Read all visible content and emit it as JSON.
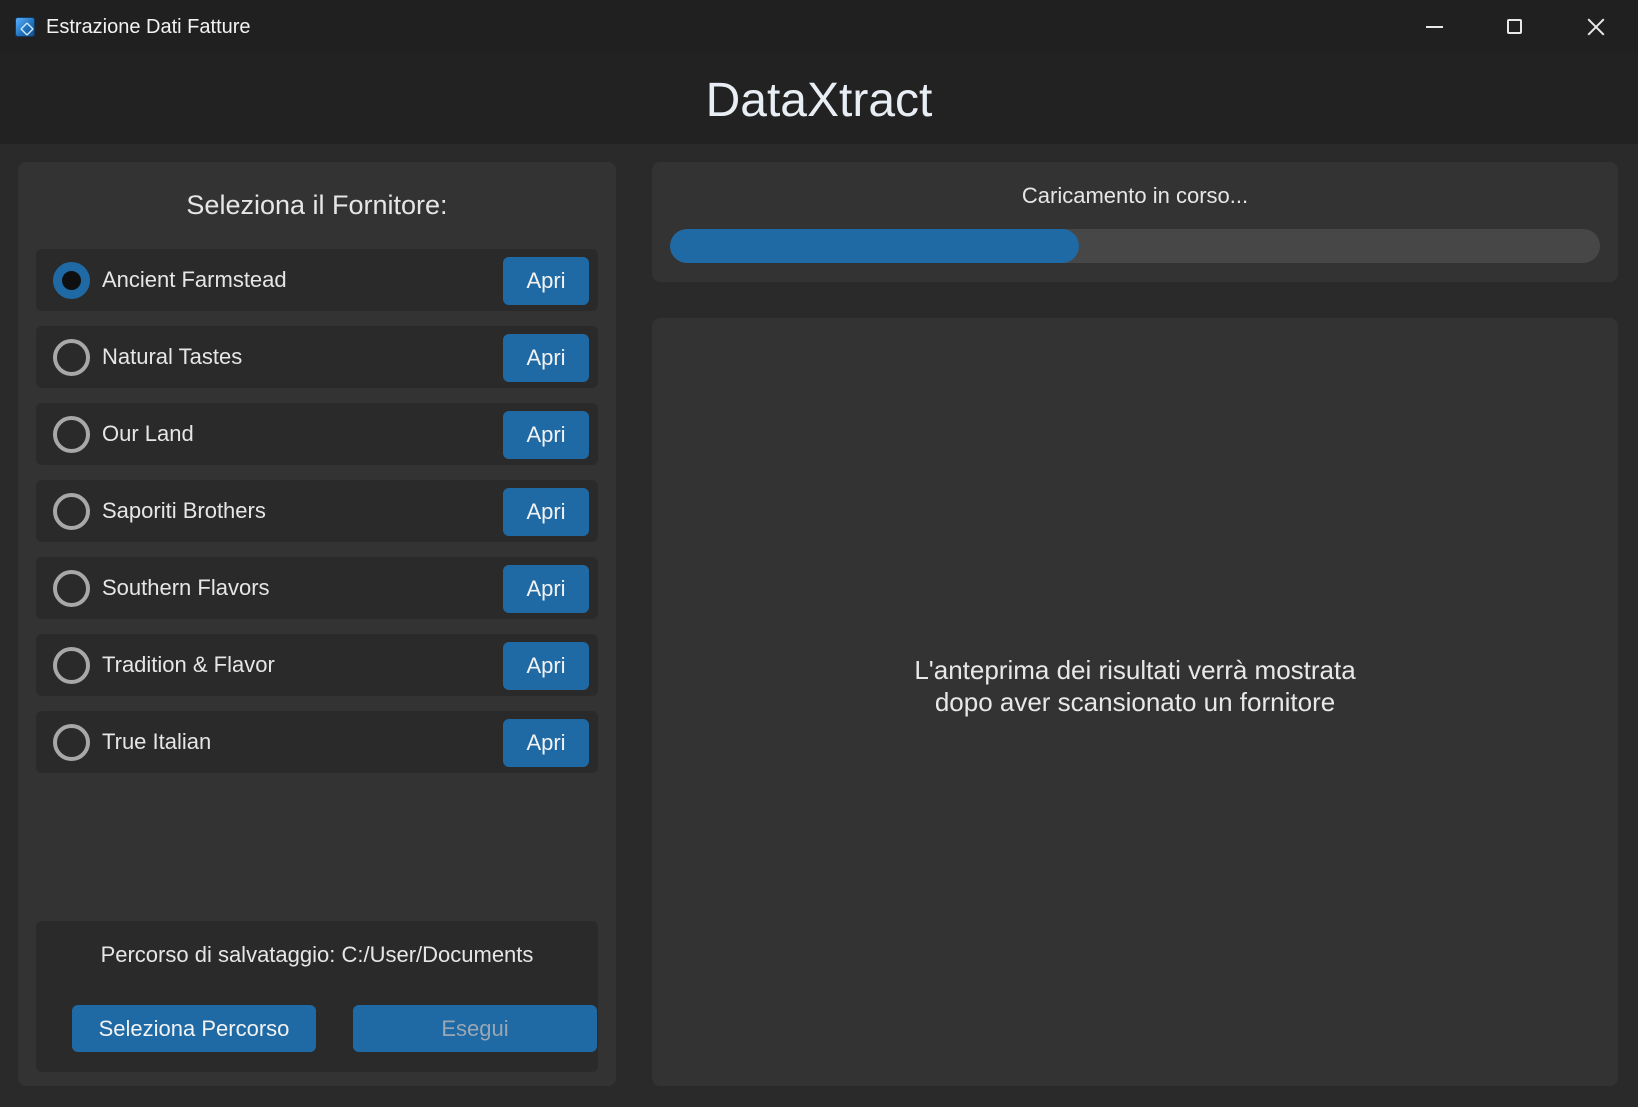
{
  "window": {
    "title": "Estrazione Dati Fatture",
    "icon": "app-icon"
  },
  "header": {
    "title": "DataXtract"
  },
  "suppliers": {
    "title": "Seleziona il Fornitore:",
    "open_label": "Apri",
    "selected": "Ancient Farmstead",
    "items": [
      {
        "label": "Ancient Farmstead",
        "checked": true
      },
      {
        "label": "Natural Tastes",
        "checked": false
      },
      {
        "label": "Our Land",
        "checked": false
      },
      {
        "label": "Saporiti Brothers",
        "checked": false
      },
      {
        "label": "Southern Flavors",
        "checked": false
      },
      {
        "label": "Tradition & Flavor",
        "checked": false
      },
      {
        "label": "True Italian",
        "checked": false
      }
    ]
  },
  "save": {
    "path_text": "Percorso di salvataggio: C:/User/Documents",
    "select_path_label": "Seleziona Percorso",
    "run_label": "Esegui",
    "run_enabled": false
  },
  "progress": {
    "label": "Caricamento in corso...",
    "fraction": 0.44
  },
  "preview": {
    "placeholder": "L'anteprima dei risultati verrà mostrata dopo aver scansionato un fornitore"
  },
  "colors": {
    "accent": "#1f6aa5",
    "panel": "#333333",
    "background": "#2a2a2a"
  }
}
